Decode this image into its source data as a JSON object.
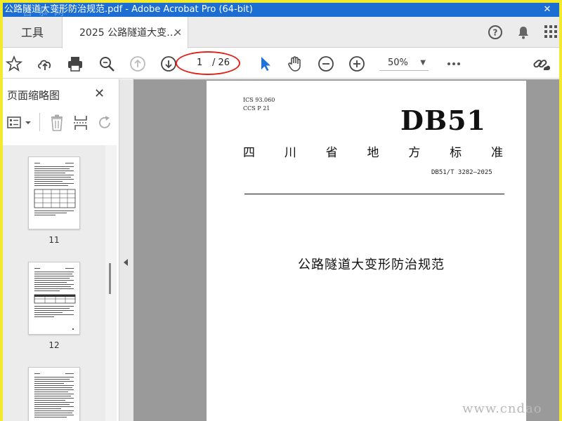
{
  "window": {
    "title": "公路隧道大变形防治规范.pdf - Adobe Acrobat Pro (64-bit)",
    "close_glyph": "✕"
  },
  "tabs": {
    "tools_label": "工具",
    "document_label": "2025 公路隧道大变…",
    "close_glyph": "✕"
  },
  "toolbar": {
    "current_page": "1",
    "total_pages": "/ 26",
    "zoom": "50%"
  },
  "sidebar": {
    "title": "页面缩略图",
    "close_glyph": "✕",
    "thumbnails": [
      {
        "page": "11"
      },
      {
        "page": "12"
      }
    ]
  },
  "document": {
    "ics_line": "ICS  93.060",
    "ccs_line": "CCS  P  21",
    "standard_code": "DB51",
    "province_chars": [
      "四",
      "川",
      "省",
      "地",
      "方",
      "标",
      "准"
    ],
    "standard_number": "DB51/T 3282—2025",
    "title": "公路隧道大变形防治规范"
  },
  "watermark": {
    "text": "www.cndao"
  },
  "colors": {
    "titlebar": "#1c6ed2",
    "highlight": "#e0231d",
    "frame": "#f3ea2c"
  },
  "icons": [
    "star-icon",
    "cloud-upload-icon",
    "print-icon",
    "zoom-search-icon",
    "page-up-icon",
    "page-down-icon",
    "select-cursor-icon",
    "hand-icon",
    "zoom-out-icon",
    "zoom-in-icon",
    "more-icon",
    "share-link-icon",
    "help-icon",
    "bell-icon",
    "apps-grid-icon"
  ]
}
